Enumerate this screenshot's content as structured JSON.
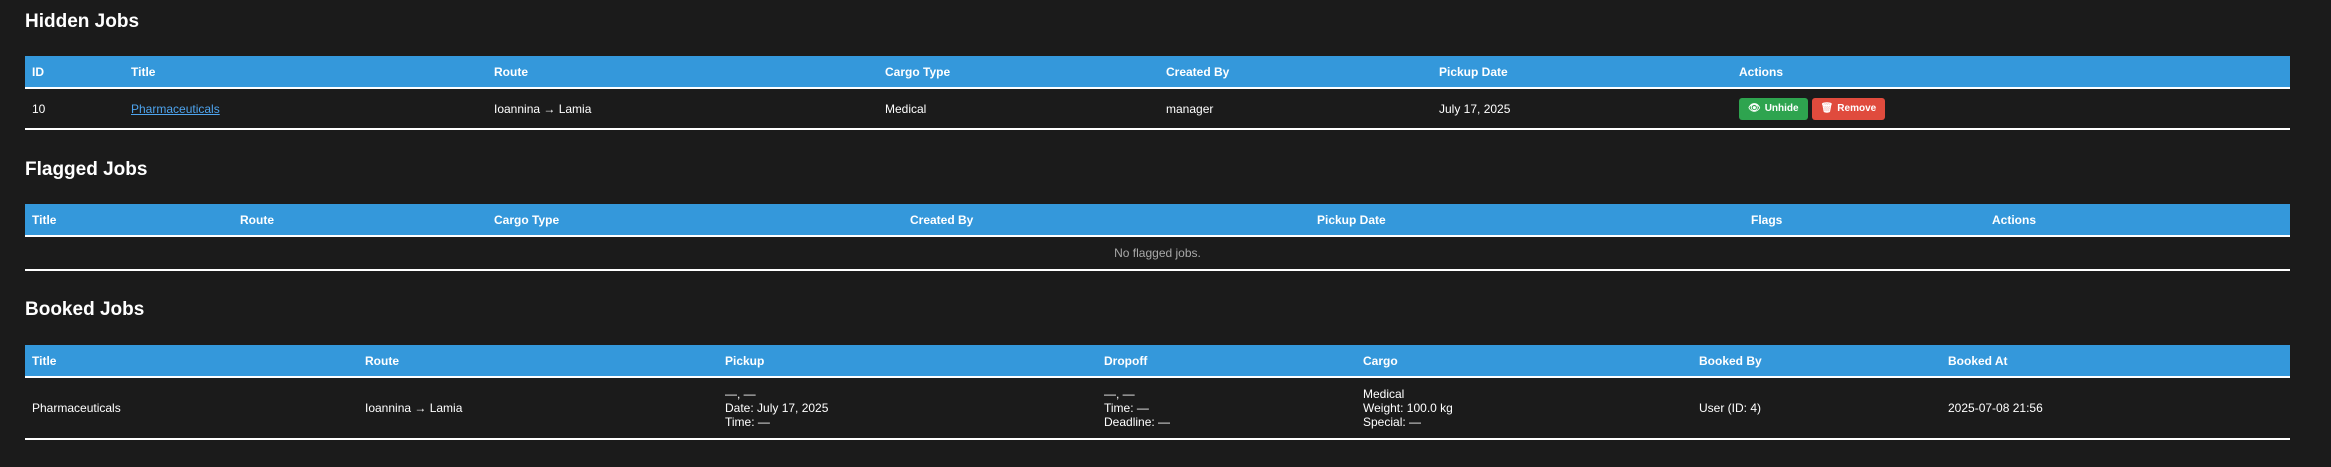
{
  "hidden_jobs": {
    "heading": "Hidden Jobs",
    "columns": [
      "ID",
      "Title",
      "Route",
      "Cargo Type",
      "Created By",
      "Pickup Date",
      "Actions"
    ],
    "rows": [
      {
        "id": "10",
        "title": "Pharmaceuticals",
        "route": "Ioannina → Lamia",
        "cargo_type": "Medical",
        "created_by": "manager",
        "pickup_date": "July 17, 2025",
        "unhide_label": "Unhide",
        "remove_label": "Remove"
      }
    ]
  },
  "flagged_jobs": {
    "heading": "Flagged Jobs",
    "columns": [
      "Title",
      "Route",
      "Cargo Type",
      "Created By",
      "Pickup Date",
      "Flags",
      "Actions"
    ],
    "empty_text": "No flagged jobs."
  },
  "booked_jobs": {
    "heading": "Booked Jobs",
    "columns": [
      "Title",
      "Route",
      "Pickup",
      "Dropoff",
      "Cargo",
      "Booked By",
      "Booked At"
    ],
    "rows": [
      {
        "title": "Pharmaceuticals",
        "route": "Ioannina → Lamia",
        "pickup_line1": "—, —",
        "pickup_line2": "Date: July 17, 2025",
        "pickup_line3": "Time: —",
        "dropoff_line1": "—, —",
        "dropoff_line2": "Time: —",
        "dropoff_line3": "Deadline: —",
        "cargo_line1": "Medical",
        "cargo_line2": "Weight: 100.0 kg",
        "cargo_line3": "Special: —",
        "booked_by": "User (ID: 4)",
        "booked_at": "2025-07-08 21:56"
      }
    ]
  },
  "colors": {
    "background": "#1b1b1b",
    "header_bg": "#3498db",
    "unhide": "#2ea44f",
    "remove": "#e04b3d",
    "link": "#4ea4ee"
  }
}
